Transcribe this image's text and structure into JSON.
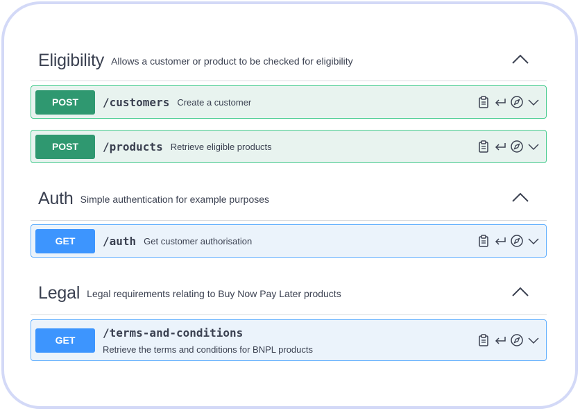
{
  "sections": [
    {
      "name": "Eligibility",
      "description": "Allows a customer or product to be checked for eligibility",
      "operations": [
        {
          "method": "POST",
          "path": "/customers",
          "summary": "Create a customer"
        },
        {
          "method": "POST",
          "path": "/products",
          "summary": "Retrieve eligible products"
        }
      ]
    },
    {
      "name": "Auth",
      "description": "Simple authentication for example purposes",
      "operations": [
        {
          "method": "GET",
          "path": "/auth",
          "summary": "Get customer authorisation"
        }
      ]
    },
    {
      "name": "Legal",
      "description": "Legal requirements relating to Buy Now Pay Later products",
      "operations": [
        {
          "method": "GET",
          "path": "/terms-and-conditions",
          "summary": "Retrieve the terms and conditions for BNPL products"
        }
      ]
    }
  ],
  "icons": {
    "collapse": "chevron-up-icon",
    "copy": "clipboard-icon",
    "try": "return-arrow-icon",
    "explore": "compass-icon",
    "expand": "chevron-down-icon"
  },
  "colors": {
    "post_badge": "#2f9870",
    "post_bg": "#e8f3ef",
    "post_border": "#49cc90",
    "get_badge": "#3d95fe",
    "get_bg": "#ebf3fb",
    "get_border": "#61affe",
    "frame_border": "#d3d9f7"
  }
}
